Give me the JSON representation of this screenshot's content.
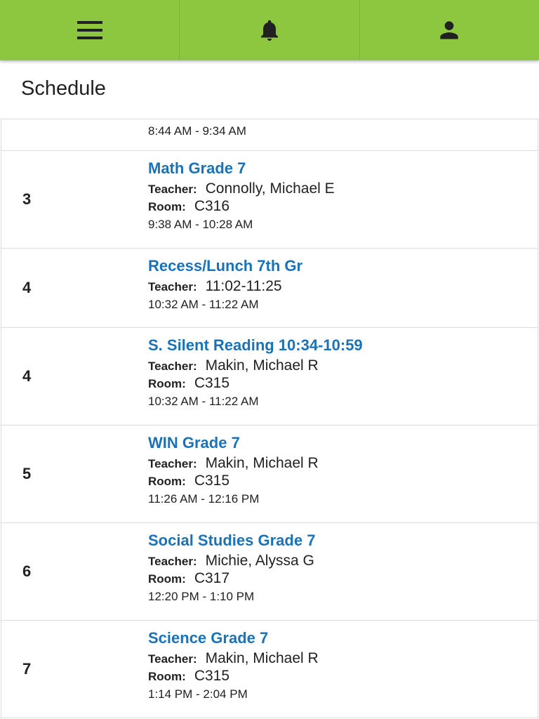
{
  "colors": {
    "header_bg": "#8dc63f",
    "course_link": "#1a73b8"
  },
  "header": {
    "icons": [
      "menu-icon",
      "bell-icon",
      "user-icon"
    ]
  },
  "page_title": "Schedule",
  "partial_row": {
    "time": "8:44 AM - 9:34 AM"
  },
  "rows": [
    {
      "period": "3",
      "course": "Math Grade 7",
      "teacher_label": "Teacher:",
      "teacher": "Connolly, Michael E",
      "room_label": "Room:",
      "room": "C316",
      "time": "9:38 AM - 10:28 AM"
    },
    {
      "period": "4",
      "course": "Recess/Lunch 7th Gr",
      "teacher_label": "Teacher:",
      "teacher": "11:02-11:25",
      "time": "10:32 AM - 11:22 AM"
    },
    {
      "period": "4",
      "course": "S. Silent Reading 10:34-10:59",
      "teacher_label": "Teacher:",
      "teacher": "Makin, Michael R",
      "room_label": "Room:",
      "room": "C315",
      "time": "10:32 AM - 11:22 AM"
    },
    {
      "period": "5",
      "course": "WIN Grade 7",
      "teacher_label": "Teacher:",
      "teacher": "Makin, Michael R",
      "room_label": "Room:",
      "room": "C315",
      "time": "11:26 AM - 12:16 PM"
    },
    {
      "period": "6",
      "course": "Social Studies Grade 7",
      "teacher_label": "Teacher:",
      "teacher": "Michie, Alyssa G",
      "room_label": "Room:",
      "room": "C317",
      "time": "12:20 PM - 1:10 PM"
    },
    {
      "period": "7",
      "course": "Science Grade 7",
      "teacher_label": "Teacher:",
      "teacher": "Makin, Michael R",
      "room_label": "Room:",
      "room": "C315",
      "time": "1:14 PM - 2:04 PM"
    }
  ]
}
